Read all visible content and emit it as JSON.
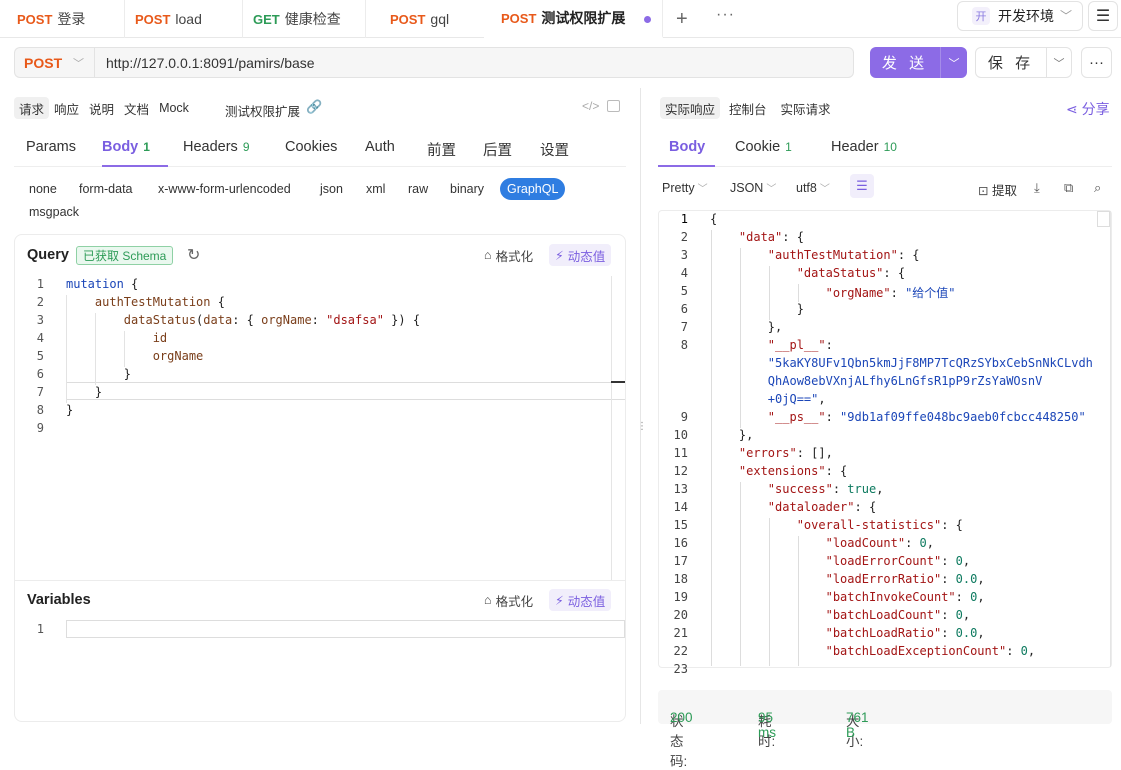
{
  "tabs": [
    {
      "method": "POST",
      "name": "登录"
    },
    {
      "method": "POST",
      "name": "load"
    },
    {
      "method": "GET",
      "name": "健康检查"
    },
    {
      "method": "POST",
      "name": "gql"
    },
    {
      "method": "POST",
      "name": "测试权限扩展"
    }
  ],
  "env": {
    "badge": "开",
    "label": "开发环境"
  },
  "request": {
    "method": "POST",
    "url": "http://127.0.0.1:8091/pamirs/base",
    "send_label": "发 送",
    "save_label": "保 存"
  },
  "left_subtabs": [
    "请求",
    "响应",
    "说明",
    "文档",
    "Mock"
  ],
  "request_name": "测试权限扩展",
  "req_tabs": [
    {
      "label": "Params",
      "count": ""
    },
    {
      "label": "Body",
      "count": "1"
    },
    {
      "label": "Headers",
      "count": "9"
    },
    {
      "label": "Cookies",
      "count": ""
    },
    {
      "label": "Auth",
      "count": ""
    },
    {
      "label": "前置",
      "count": ""
    },
    {
      "label": "后置",
      "count": ""
    },
    {
      "label": "设置",
      "count": ""
    }
  ],
  "body_types": [
    "none",
    "form-data",
    "x-www-form-urlencoded",
    "json",
    "xml",
    "raw",
    "binary",
    "GraphQL",
    "msgpack"
  ],
  "query": {
    "title": "Query",
    "schema_badge": "已获取 Schema",
    "format_label": "格式化",
    "dynamic_label": "动态值",
    "line_numbers": [
      "1",
      "2",
      "3",
      "4",
      "5",
      "6",
      "7",
      "8",
      "9"
    ]
  },
  "variables": {
    "title": "Variables",
    "format_label": "格式化",
    "dynamic_label": "动态值",
    "line_numbers": [
      "1"
    ]
  },
  "right_subtabs": [
    "实际响应",
    "控制台",
    "实际请求"
  ],
  "share_label": "分享",
  "resp_tabs": [
    {
      "label": "Body",
      "count": ""
    },
    {
      "label": "Cookie",
      "count": "1"
    },
    {
      "label": "Header",
      "count": "10"
    }
  ],
  "resp_format": {
    "pretty": "Pretty",
    "type": "JSON",
    "encoding": "utf8",
    "extract": "提取"
  },
  "response_line_numbers": [
    "1",
    "2",
    "3",
    "4",
    "5",
    "6",
    "7",
    "8",
    "9",
    "10",
    "11",
    "12",
    "13",
    "14",
    "15",
    "16",
    "17",
    "18",
    "19",
    "20",
    "21",
    "22",
    "23"
  ],
  "status": {
    "code_label": "状态码:",
    "code": "200",
    "time_label": "耗时:",
    "time": "95 ms",
    "size_label": "大小:",
    "size": "761 B"
  },
  "colors": {
    "accent": "#8c6be6",
    "post": "#e8591a",
    "get": "#2d9b57",
    "selected_body_type": "#2f7de1"
  }
}
